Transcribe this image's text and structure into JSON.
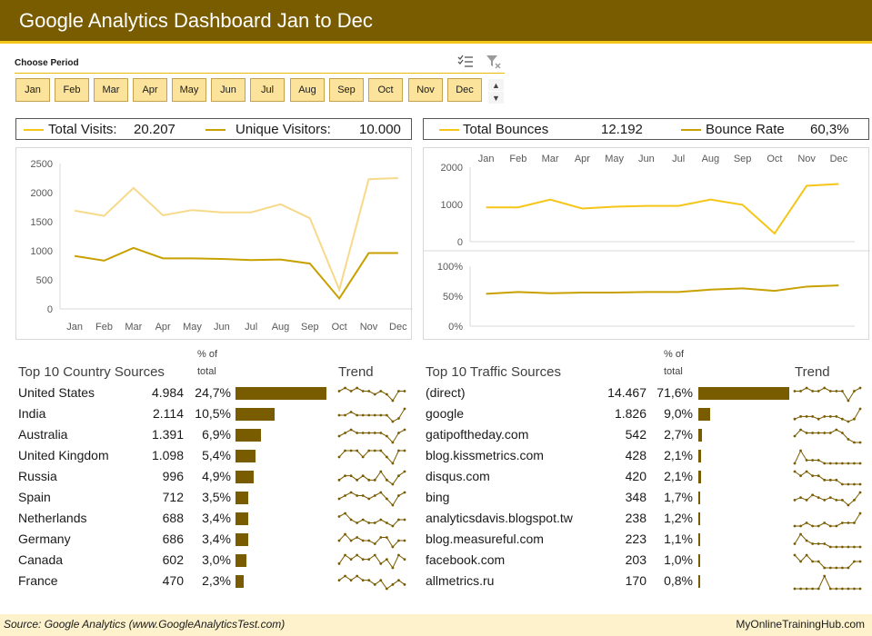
{
  "header": {
    "title": "Google Analytics Dashboard Jan to Dec"
  },
  "colors": {
    "header_bg": "#7a5c00",
    "accent_light": "#f5c518",
    "accent_dark": "#c8a000",
    "bar": "#7a5c00",
    "slicer_btn": "#fce39b"
  },
  "slicer": {
    "title": "Choose Period",
    "icons": [
      "multi-select-icon",
      "clear-filter-icon"
    ],
    "months": [
      "Jan",
      "Feb",
      "Mar",
      "Apr",
      "May",
      "Jun",
      "Jul",
      "Aug",
      "Sep",
      "Oct",
      "Nov",
      "Dec"
    ]
  },
  "visits_legend": {
    "total_label": "Total Visits:",
    "total_value": "20.207",
    "unique_label": "Unique Visitors:",
    "unique_value": "10.000"
  },
  "bounce_legend": {
    "total_label": "Total Bounces",
    "total_value": "12.192",
    "rate_label": "Bounce Rate",
    "rate_value": "60,3%"
  },
  "chart_data": [
    {
      "type": "line",
      "x": [
        "Jan",
        "Feb",
        "Mar",
        "Apr",
        "May",
        "Jun",
        "Jul",
        "Aug",
        "Sep",
        "Oct",
        "Nov",
        "Dec"
      ],
      "series": [
        {
          "name": "Total Visits",
          "color": "#f7d98a",
          "values": [
            1690,
            1600,
            2080,
            1610,
            1700,
            1660,
            1660,
            1800,
            1560,
            330,
            2230,
            2250
          ]
        },
        {
          "name": "Unique Visitors",
          "color": "#c8a000",
          "values": [
            910,
            830,
            1050,
            870,
            870,
            860,
            840,
            850,
            780,
            180,
            960,
            960
          ]
        }
      ],
      "ylim": [
        0,
        2500
      ],
      "yticks": [
        "2500",
        "2000",
        "1500",
        "1000",
        "500",
        "0"
      ],
      "grid": false
    },
    {
      "type": "line",
      "x": [
        "Jan",
        "Feb",
        "Mar",
        "Apr",
        "May",
        "Jun",
        "Jul",
        "Aug",
        "Sep",
        "Oct",
        "Nov",
        "Dec"
      ],
      "series": [
        {
          "name": "Total Bounces",
          "color": "#f5c518",
          "values": [
            920,
            920,
            1130,
            890,
            940,
            960,
            960,
            1130,
            990,
            220,
            1500,
            1550
          ]
        }
      ],
      "ylim": [
        0,
        2000
      ],
      "yticks": [
        "2000",
        "1000",
        "0"
      ],
      "grid": false
    },
    {
      "type": "line",
      "x": [
        "Jan",
        "Feb",
        "Mar",
        "Apr",
        "May",
        "Jun",
        "Jul",
        "Aug",
        "Sep",
        "Oct",
        "Nov",
        "Dec"
      ],
      "series": [
        {
          "name": "Bounce Rate",
          "color": "#c8a000",
          "values": [
            54,
            57,
            55,
            56,
            56,
            57,
            57,
            61,
            63,
            59,
            66,
            68
          ]
        }
      ],
      "ylim": [
        0,
        100
      ],
      "yticks": [
        "100%",
        "50%",
        "0%"
      ],
      "grid": false
    }
  ],
  "country_table": {
    "title": "Top 10 Country Sources",
    "pct_header_1": "% of",
    "pct_header_2": "total",
    "trend_header": "Trend",
    "rows": [
      {
        "name": "United States",
        "value": "4.984",
        "pct": "24,7%",
        "share": 24.7,
        "trend": [
          5,
          6,
          5,
          6,
          5,
          5,
          4,
          5,
          4,
          2,
          5,
          5
        ]
      },
      {
        "name": "India",
        "value": "2.114",
        "pct": "10,5%",
        "share": 10.5,
        "trend": [
          4,
          4,
          5,
          4,
          4,
          4,
          4,
          4,
          4,
          2,
          3,
          6
        ]
      },
      {
        "name": "Australia",
        "value": "1.391",
        "pct": "6,9%",
        "share": 6.9,
        "trend": [
          4,
          5,
          6,
          5,
          5,
          5,
          5,
          5,
          4,
          2,
          5,
          6
        ]
      },
      {
        "name": "United Kingdom",
        "value": "1.098",
        "pct": "5,4%",
        "share": 5.4,
        "trend": [
          4,
          5,
          5,
          5,
          4,
          5,
          5,
          5,
          4,
          3,
          5,
          5
        ]
      },
      {
        "name": "Russia",
        "value": "996",
        "pct": "4,9%",
        "share": 4.9,
        "trend": [
          3,
          4,
          4,
          3,
          4,
          3,
          3,
          5,
          3,
          2,
          4,
          5
        ]
      },
      {
        "name": "Spain",
        "value": "712",
        "pct": "3,5%",
        "share": 3.5,
        "trend": [
          4,
          5,
          6,
          5,
          5,
          4,
          5,
          6,
          4,
          2,
          5,
          6
        ]
      },
      {
        "name": "Netherlands",
        "value": "688",
        "pct": "3,4%",
        "share": 3.4,
        "trend": [
          5,
          6,
          4,
          3,
          4,
          3,
          3,
          4,
          3,
          2,
          4,
          4
        ]
      },
      {
        "name": "Germany",
        "value": "686",
        "pct": "3,4%",
        "share": 3.4,
        "trend": [
          4,
          6,
          4,
          5,
          4,
          4,
          3,
          5,
          5,
          2,
          4,
          4
        ]
      },
      {
        "name": "Canada",
        "value": "602",
        "pct": "3,0%",
        "share": 3.0,
        "trend": [
          3,
          5,
          4,
          5,
          4,
          4,
          5,
          3,
          4,
          2,
          5,
          4
        ]
      },
      {
        "name": "France",
        "value": "470",
        "pct": "2,3%",
        "share": 2.3,
        "trend": [
          4,
          5,
          4,
          5,
          4,
          4,
          3,
          4,
          2,
          3,
          4,
          3
        ]
      }
    ]
  },
  "traffic_table": {
    "title": "Top 10 Traffic Sources",
    "pct_header_1": "% of",
    "pct_header_2": "total",
    "trend_header": "Trend",
    "rows": [
      {
        "name": "(direct)",
        "value": "14.467",
        "pct": "71,6%",
        "share": 71.6,
        "trend": [
          5,
          5,
          6,
          5,
          5,
          6,
          5,
          5,
          5,
          2,
          5,
          6
        ]
      },
      {
        "name": "google",
        "value": "1.826",
        "pct": "9,0%",
        "share": 9.0,
        "trend": [
          3,
          4,
          4,
          4,
          3,
          4,
          4,
          4,
          3,
          2,
          3,
          7
        ]
      },
      {
        "name": "gatipoftheday.com",
        "value": "542",
        "pct": "2,7%",
        "share": 2.7,
        "trend": [
          4,
          6,
          5,
          5,
          5,
          5,
          5,
          6,
          5,
          3,
          2,
          2
        ]
      },
      {
        "name": "blog.kissmetrics.com",
        "value": "428",
        "pct": "2,1%",
        "share": 2.1,
        "trend": [
          2,
          6,
          3,
          3,
          3,
          2,
          2,
          2,
          2,
          2,
          2,
          2
        ]
      },
      {
        "name": "disqus.com",
        "value": "420",
        "pct": "2,1%",
        "share": 2.1,
        "trend": [
          6,
          5,
          6,
          5,
          5,
          4,
          4,
          4,
          3,
          3,
          3,
          3
        ]
      },
      {
        "name": "bing",
        "value": "348",
        "pct": "1,7%",
        "share": 1.7,
        "trend": [
          4,
          5,
          4,
          6,
          5,
          4,
          5,
          4,
          4,
          2,
          4,
          7
        ]
      },
      {
        "name": "analyticsdavis.blogspot.tw",
        "value": "238",
        "pct": "1,2%",
        "share": 1.2,
        "trend": [
          3,
          3,
          4,
          3,
          3,
          4,
          3,
          3,
          4,
          4,
          4,
          7
        ]
      },
      {
        "name": "blog.measureful.com",
        "value": "223",
        "pct": "1,1%",
        "share": 1.1,
        "trend": [
          4,
          7,
          5,
          4,
          4,
          4,
          3,
          3,
          3,
          3,
          3,
          3
        ]
      },
      {
        "name": "facebook.com",
        "value": "203",
        "pct": "1,0%",
        "share": 1.0,
        "trend": [
          5,
          4,
          5,
          4,
          4,
          3,
          3,
          3,
          3,
          3,
          4,
          4
        ]
      },
      {
        "name": "allmetrics.ru",
        "value": "170",
        "pct": "0,8%",
        "share": 0.8,
        "trend": [
          3,
          3,
          3,
          3,
          3,
          4,
          3,
          3,
          3,
          3,
          3,
          3
        ]
      }
    ]
  },
  "footer": {
    "source": "Source: Google Analytics (www.GoogleAnalyticsTest.com)",
    "credit": "MyOnlineTrainingHub.com"
  }
}
